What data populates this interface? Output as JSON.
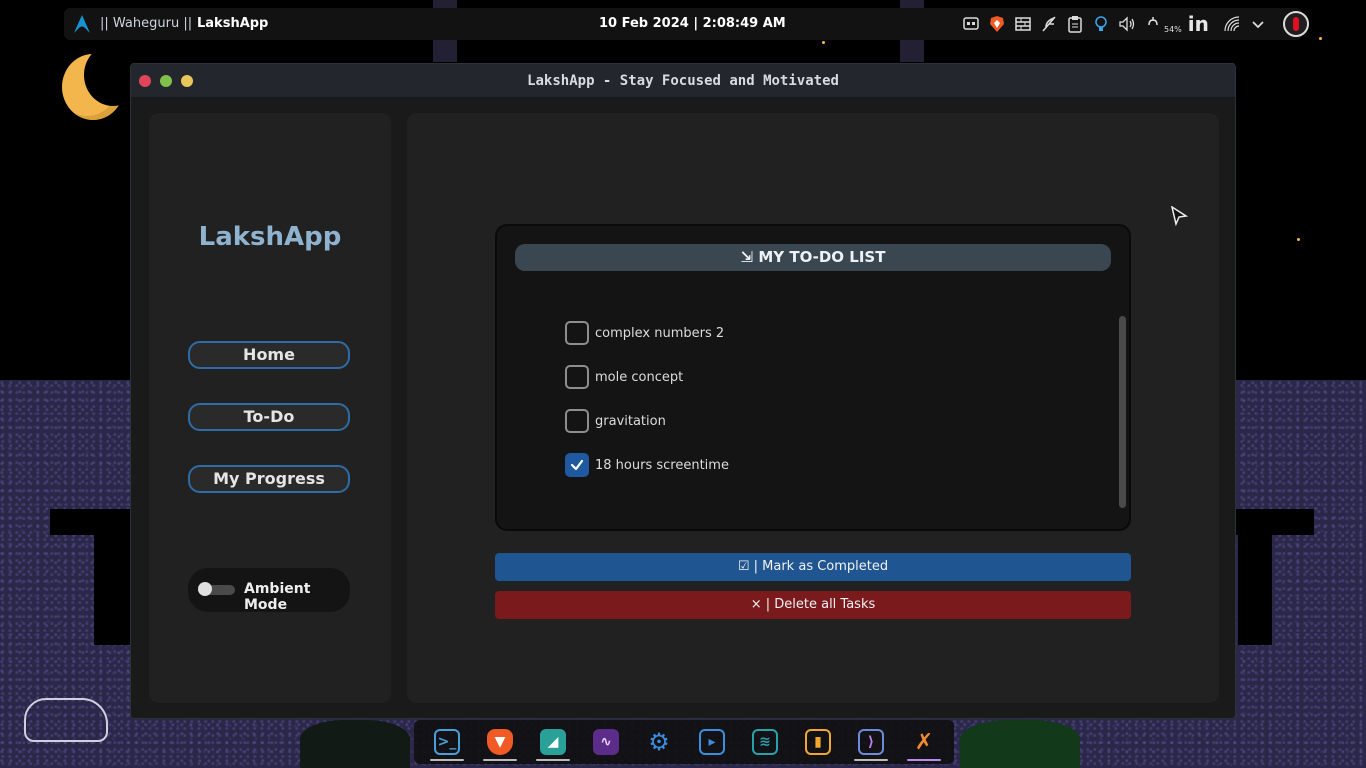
{
  "topbar": {
    "workspace_label": "|| Waheguru ||",
    "app_label": "LakshApp",
    "clock": "10 Feb 2024 | 2:08:49 AM",
    "battery_percent": "54%",
    "linkedin_label": "in",
    "tray_icons": [
      "subtitles-icon",
      "brave-icon",
      "firewall-icon",
      "feather-icon",
      "clipboard-icon",
      "bulb-icon",
      "volume-icon",
      "battery-icon"
    ]
  },
  "window": {
    "title": "LakshApp - Stay Focused and Motivated"
  },
  "sidebar": {
    "brand": "LakshApp",
    "nav": {
      "home": "Home",
      "todo": "To-Do",
      "progress": "My Progress"
    },
    "ambient_label": "Ambient Mode",
    "ambient_on": false
  },
  "todo": {
    "header": "⇲ MY TO-DO LIST",
    "tasks": [
      {
        "label": "complex numbers 2",
        "checked": false
      },
      {
        "label": "mole concept",
        "checked": false
      },
      {
        "label": "gravitation",
        "checked": false
      },
      {
        "label": "18 hours screentime",
        "checked": true
      }
    ],
    "mark_completed_label": "☑ | Mark as Completed",
    "delete_all_label": "× | Delete all Tasks"
  },
  "dock": {
    "apps": [
      "terminal-icon",
      "brave-icon",
      "kde-connect-icon",
      "system-monitor-icon",
      "settings-icon",
      "app-store-icon",
      "spotify-icon",
      "book-icon",
      "vscode-icon",
      "lakshapp-icon"
    ],
    "active": "lakshapp-icon"
  },
  "colors": {
    "accent_blue": "#1f5591",
    "danger_red": "#7b1a1c",
    "brand_text": "#8fb2cf",
    "nav_border": "#2e6ca6"
  }
}
